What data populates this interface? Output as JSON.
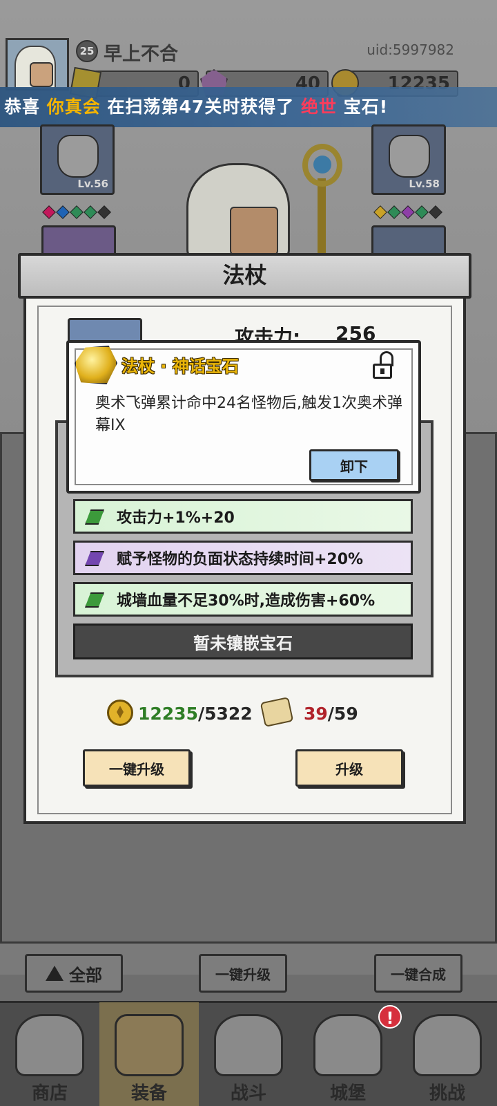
{
  "player": {
    "level": "25",
    "name": "早上不合",
    "uid": "uid:5997982"
  },
  "currencies": [
    {
      "icon": "ticket-icon",
      "value": "0"
    },
    {
      "icon": "purple-gem-icon",
      "value": "40"
    },
    {
      "icon": "gold-coin-icon",
      "value": "12235"
    }
  ],
  "banner": {
    "prefix": "恭喜",
    "player": "你真会",
    "middle": "在扫荡第47关时获得了",
    "quality": "绝世",
    "suffix": "宝石!"
  },
  "equipment": {
    "left_slot_level": "Lv.56",
    "right_slot_level": "Lv.58",
    "left_dots": [
      "#c2185b",
      "#1e63b5",
      "#2e8b57",
      "#2e8b57",
      "#333333"
    ],
    "right_dots": [
      "#c9a227",
      "#2e8b57",
      "#8e3fa7",
      "#2e8b57",
      "#333333"
    ]
  },
  "dialog": {
    "title": "法杖",
    "attack_label": "攻击力:",
    "attack_value": "256",
    "gem_rows": [
      {
        "text": "攻击力+1%+20",
        "gem": "green"
      },
      {
        "text": "赋予怪物的负面状态持续时间+20%",
        "gem": "purple"
      },
      {
        "text": "城墙血量不足30%时,造成伤害+60%",
        "gem": "green"
      }
    ],
    "empty_slot": "暂未镶嵌宝石",
    "cost": {
      "gold_have": "12235",
      "gold_need": "/5322",
      "scroll_have": "39",
      "scroll_need": "/59"
    },
    "btn_upgrade_all": "一键升级",
    "btn_upgrade": "升级"
  },
  "tooltip": {
    "title": "法杖 · 神话宝石",
    "description": "奥术飞弹累计命中24名怪物后,触发1次奥术弹幕IX",
    "unequip": "卸下"
  },
  "bottom_buttons": {
    "filter_all": "全部",
    "upgrade_all": "一键升级",
    "merge_all": "一键合成"
  },
  "nav": [
    {
      "label": "商店",
      "icon": "shop-icon"
    },
    {
      "label": "装备",
      "icon": "equipment-bag-icon",
      "active": true
    },
    {
      "label": "战斗",
      "icon": "crossed-swords-icon"
    },
    {
      "label": "城堡",
      "icon": "castle-icon"
    },
    {
      "label": "挑战",
      "icon": "challenge-shield-icon"
    }
  ],
  "nav_alert": "!",
  "colors": {
    "banner_highlight_player": "#f4b400",
    "banner_highlight_quality": "#ff3c5a",
    "tooltip_title": "#eab509",
    "cost_have_gold": "#2e7d25",
    "cost_have_scroll": "#b0222a"
  }
}
